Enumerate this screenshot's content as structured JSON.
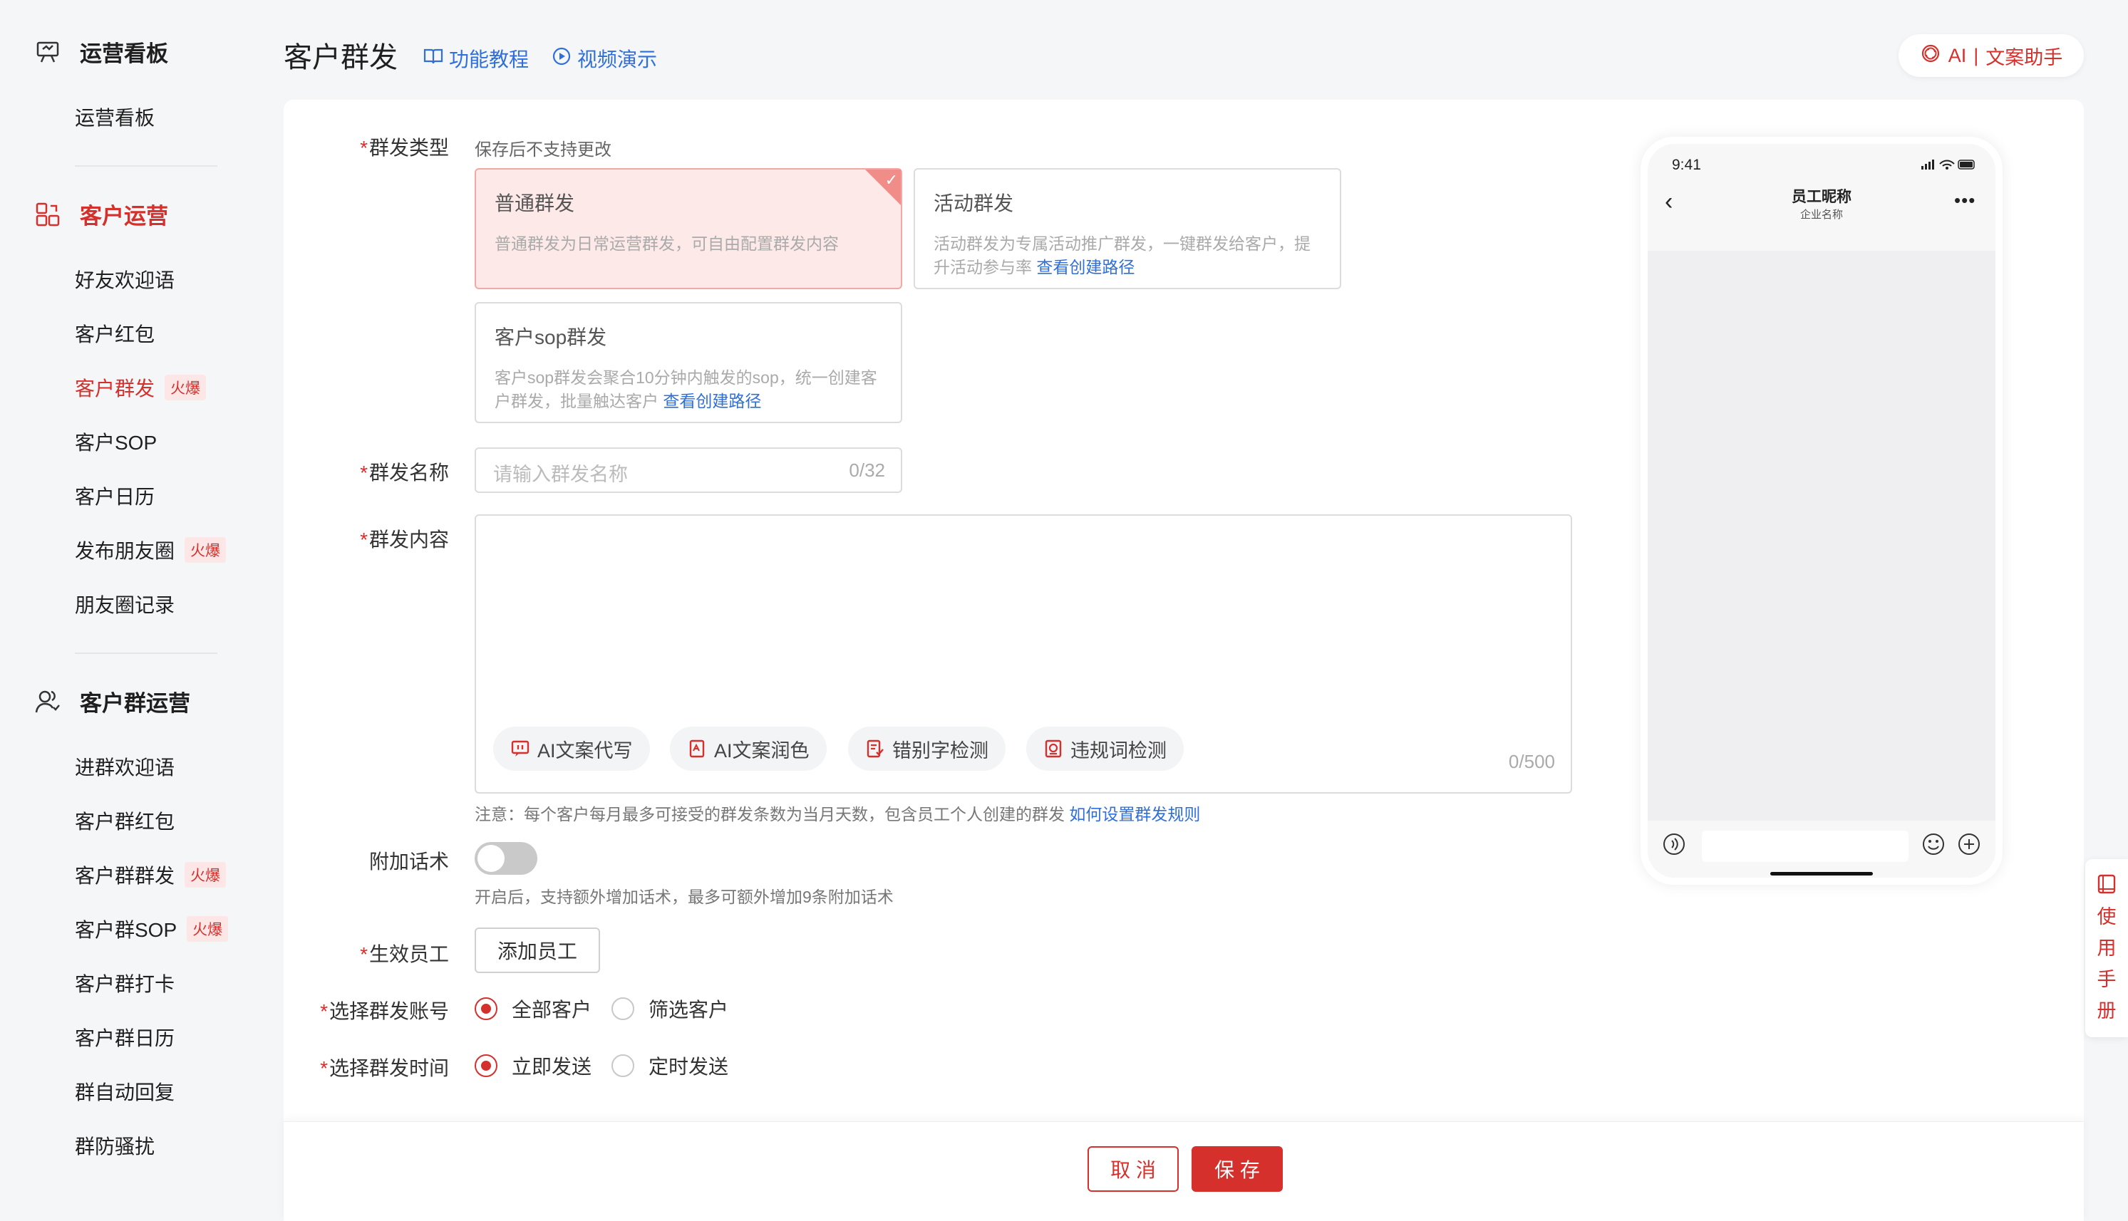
{
  "sidebar": {
    "sections": [
      {
        "title": "运营看板",
        "icon": "dashboard-icon",
        "items": [
          {
            "label": "运营看板"
          }
        ]
      },
      {
        "title": "客户运营",
        "icon": "customer-ops-icon",
        "active": true,
        "items": [
          {
            "label": "好友欢迎语"
          },
          {
            "label": "客户红包"
          },
          {
            "label": "客户群发",
            "badge": "火爆",
            "active": true
          },
          {
            "label": "客户SOP"
          },
          {
            "label": "客户日历"
          },
          {
            "label": "发布朋友圈",
            "badge": "火爆"
          },
          {
            "label": "朋友圈记录"
          }
        ]
      },
      {
        "title": "客户群运营",
        "icon": "group-ops-icon",
        "items": [
          {
            "label": "进群欢迎语"
          },
          {
            "label": "客户群红包"
          },
          {
            "label": "客户群群发",
            "badge": "火爆"
          },
          {
            "label": "客户群SOP",
            "badge": "火爆"
          },
          {
            "label": "客户群打卡"
          },
          {
            "label": "客户群日历"
          },
          {
            "label": "群自动回复"
          },
          {
            "label": "群防骚扰"
          }
        ]
      }
    ]
  },
  "header": {
    "title": "客户群发",
    "tutorial_link": "功能教程",
    "video_link": "视频演示",
    "ai_assistant": {
      "prefix": "AI",
      "label": "文案助手"
    }
  },
  "form": {
    "type": {
      "label": "群发类型",
      "hint": "保存后不支持更改",
      "options": [
        {
          "title": "普通群发",
          "desc": "普通群发为日常运营群发，可自由配置群发内容",
          "selected": true
        },
        {
          "title": "活动群发",
          "desc": "活动群发为专属活动推广群发，一键群发给客户，提升活动参与率",
          "link": "查看创建路径"
        },
        {
          "title": "客户sop群发",
          "desc": "客户sop群发会聚合10分钟内触发的sop，统一创建客户群发，批量触达客户",
          "link": "查看创建路径"
        }
      ]
    },
    "name": {
      "label": "群发名称",
      "placeholder": "请输入群发名称",
      "counter": "0/32"
    },
    "content": {
      "label": "群发内容",
      "counter": "0/500",
      "tools": [
        {
          "label": "AI文案代写",
          "icon": "ai-write-icon"
        },
        {
          "label": "AI文案润色",
          "icon": "ai-polish-icon"
        },
        {
          "label": "错别字检测",
          "icon": "typo-check-icon"
        },
        {
          "label": "违规词检测",
          "icon": "violation-check-icon"
        }
      ],
      "note": "注意：每个客户每月最多可接受的群发条数为当月天数，包含员工个人创建的群发",
      "note_link": "如何设置群发规则"
    },
    "extra": {
      "label": "附加话术",
      "enabled": false,
      "hint": "开启后，支持额外增加话术，最多可额外增加9条附加话术"
    },
    "staff": {
      "label": "生效员工",
      "button": "添加员工"
    },
    "account": {
      "label": "选择群发账号",
      "options": [
        "全部客户",
        "筛选客户"
      ],
      "selected": "全部客户"
    },
    "time": {
      "label": "选择群发时间",
      "options": [
        "立即发送",
        "定时发送"
      ],
      "selected": "立即发送"
    }
  },
  "phone": {
    "time": "9:41",
    "contact": "员工昵称",
    "company": "企业名称"
  },
  "footer": {
    "cancel": "取 消",
    "save": "保 存"
  },
  "float_manual": [
    "使",
    "用",
    "手",
    "册"
  ],
  "colors": {
    "accent": "#d5302c",
    "link": "#2f6fdb",
    "selected_bg": "#fde9e8"
  }
}
